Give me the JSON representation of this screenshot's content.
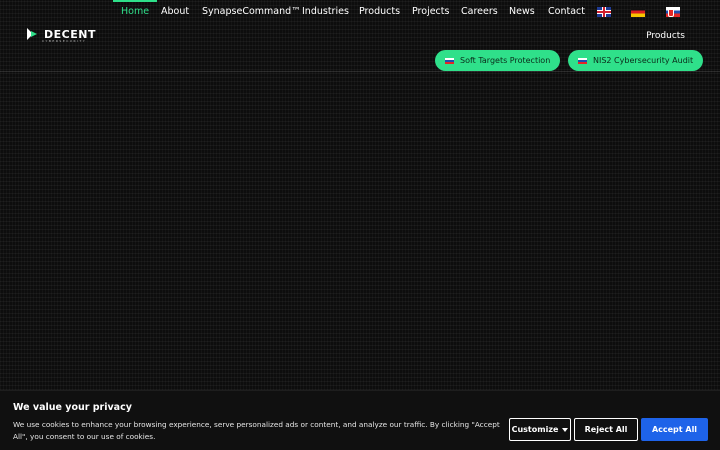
{
  "logo": {
    "name": "DECENT",
    "tagline": "CYBERSECURITY"
  },
  "nav": {
    "items": [
      {
        "label": "Home",
        "active": true
      },
      {
        "label": "About"
      },
      {
        "label": "SynapseCommand™"
      },
      {
        "label": "Industries"
      },
      {
        "label": "Products"
      },
      {
        "label": "Projects"
      },
      {
        "label": "Careers"
      },
      {
        "label": "News"
      },
      {
        "label": "Contact"
      }
    ],
    "languages": [
      "english-flag-icon",
      "german-flag-icon",
      "slovak-flag-icon"
    ],
    "accent_color": "#2fe08a"
  },
  "subnav": {
    "products_label": "Products",
    "pills": [
      {
        "label": "Soft Targets Protection",
        "icon": "slovak-flag-icon"
      },
      {
        "label": "NIS2 Cybersecurity Audit",
        "icon": "slovak-flag-icon"
      }
    ]
  },
  "cookie": {
    "title": "We value your privacy",
    "text": "We use cookies to enhance your browsing experience, serve personalized ads or content, and analyze our traffic. By clicking \"Accept All\", you consent to our use of cookies.",
    "customize_label": "Customize",
    "reject_label": "Reject All",
    "accept_label": "Accept All",
    "accept_color": "#1e63e9"
  }
}
